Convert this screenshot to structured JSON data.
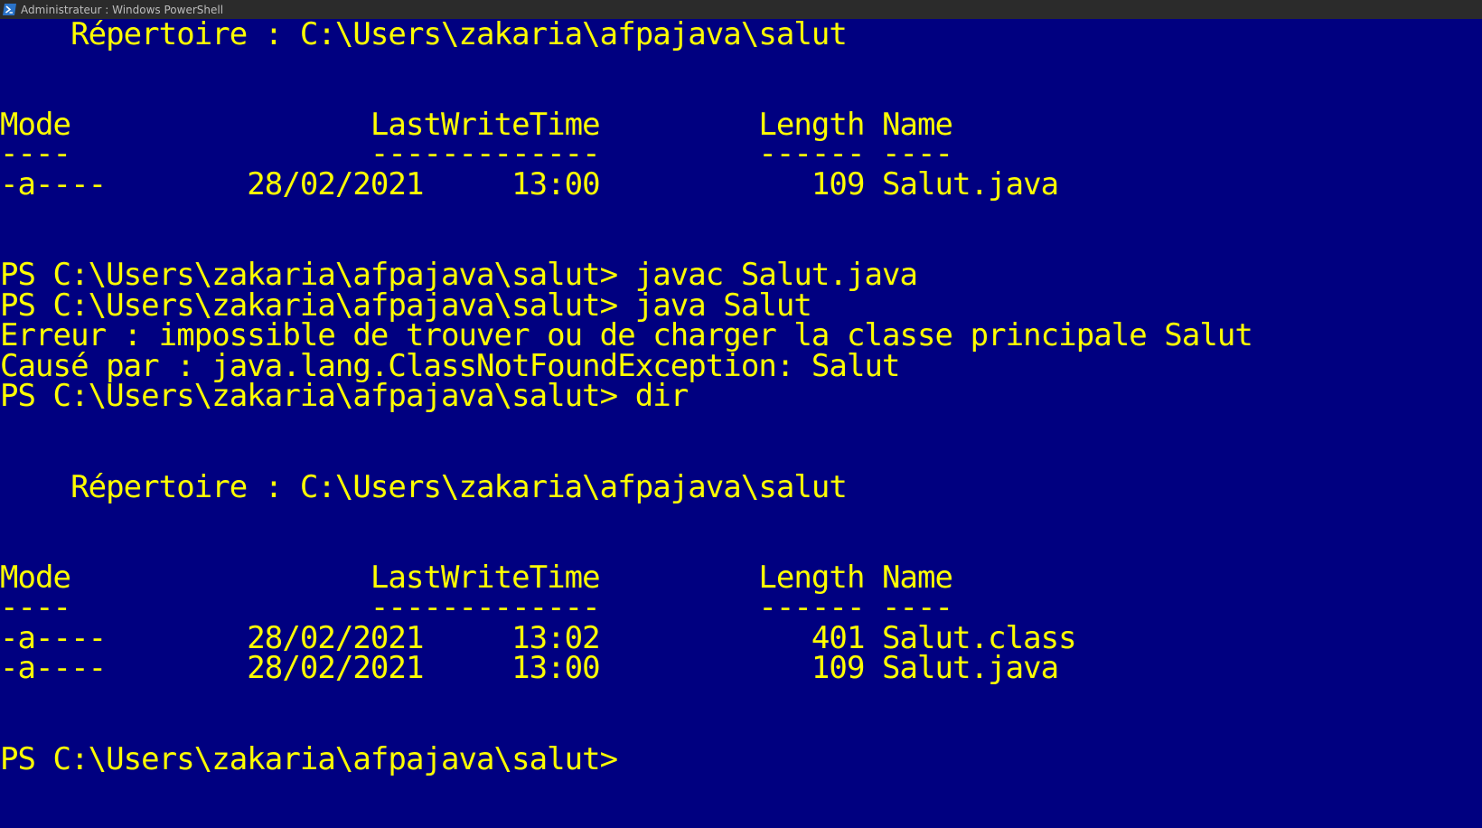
{
  "window": {
    "title": "Administrateur : Windows PowerShell",
    "icon": "powershell-icon",
    "background": "#000080",
    "foreground": "#ffff00"
  },
  "console": {
    "lines": [
      "    Répertoire : C:\\Users\\zakaria\\afpajava\\salut",
      "Mode                 LastWriteTime         Length Name",
      "----                 -------------         ------ ----",
      "-a----        28/02/2021     13:00            109 Salut.java",
      "PS C:\\Users\\zakaria\\afpajava\\salut> javac Salut.java",
      "PS C:\\Users\\zakaria\\afpajava\\salut> java Salut",
      "Erreur : impossible de trouver ou de charger la classe principale Salut",
      "Causé par : java.lang.ClassNotFoundException: Salut",
      "PS C:\\Users\\zakaria\\afpajava\\salut> dir",
      "    Répertoire : C:\\Users\\zakaria\\afpajava\\salut",
      "Mode                 LastWriteTime         Length Name",
      "----                 -------------         ------ ----",
      "-a----        28/02/2021     13:02            401 Salut.class",
      "-a----        28/02/2021     13:00            109 Salut.java",
      "PS C:\\Users\\zakaria\\afpajava\\salut>"
    ]
  }
}
